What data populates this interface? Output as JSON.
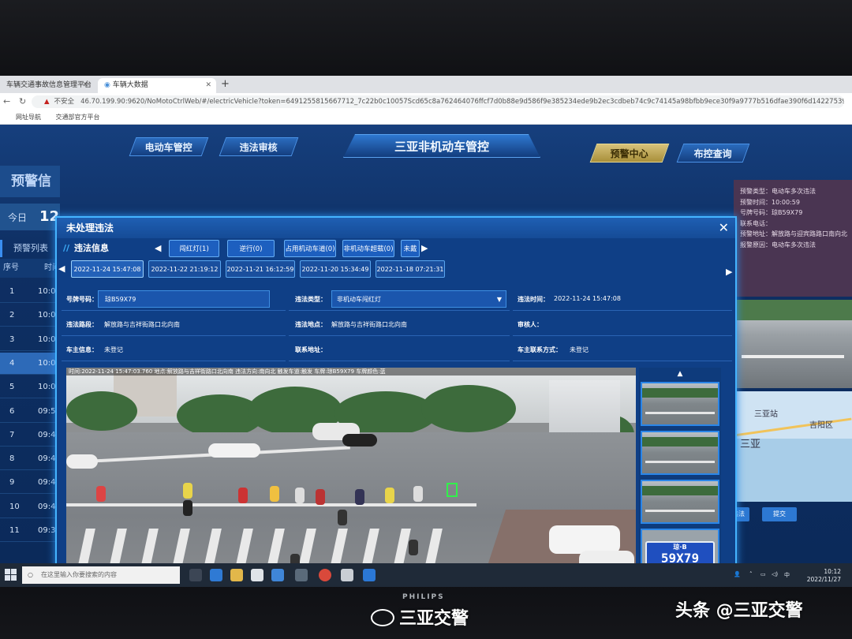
{
  "browser": {
    "tabs": [
      {
        "label": "车辆交通事故信息管理平台"
      },
      {
        "label": "车辆大数据"
      }
    ],
    "insecure_label": "不安全",
    "url": "46.70.199.90:9620/NoMotoCtrlWeb/#/electricVehicle?token=6491255815667712_7c22b0c10057Scd65c8a762464076ffcf7d0b88e9d586f9e385234ede9b2ec3cdbeb74c9c74145a98bfbb9ece30f9a9777b516dfae390f6d1422753989401272",
    "bookmarks": [
      "网址导航",
      "交通部官方平台"
    ]
  },
  "app": {
    "title": "三亚非机动车管控",
    "nav": [
      "电动车管控",
      "违法审核",
      "预警中心",
      "布控查询"
    ]
  },
  "left": {
    "heading": "预警信",
    "today_label": "今日",
    "today_count": "12",
    "list_title": "预警列表",
    "col_no": "序号",
    "col_time": "时间",
    "rows": [
      {
        "no": "1",
        "time": "10:08"
      },
      {
        "no": "2",
        "time": "10:07"
      },
      {
        "no": "3",
        "time": "10:05"
      },
      {
        "no": "4",
        "time": "10:00"
      },
      {
        "no": "5",
        "time": "10:00"
      },
      {
        "no": "6",
        "time": "09:55"
      },
      {
        "no": "7",
        "time": "09:49"
      },
      {
        "no": "8",
        "time": "09:48"
      },
      {
        "no": "9",
        "time": "09:45"
      },
      {
        "no": "10",
        "time": "09:42"
      },
      {
        "no": "11",
        "time": "09:31"
      }
    ]
  },
  "right": {
    "info_lines": [
      "预警类型：电动车多次违法",
      "预警时间：10:00:59",
      "号牌号码：琼B59X79",
      "联系电话：",
      "预警地址：解放路与迎宾路路口南向北",
      "报警原因：电动车多次违法"
    ],
    "map_labels": [
      "三亚站",
      "吉阳区",
      "三亚"
    ],
    "buttons": [
      "处理违法",
      "提交"
    ]
  },
  "dialog": {
    "title": "未处理违法",
    "section": "违法信息",
    "categories": [
      "闯红灯(1)",
      "逆行(0)",
      "占用机动车道(0)",
      "非机动车超载(0)",
      "未戴"
    ],
    "dates": [
      "2022-11-24 15:47:08",
      "2022-11-22 21:19:12",
      "2022-11-21 16:12:59",
      "2022-11-20 15:34:49",
      "2022-11-18 07:21:31"
    ],
    "fields": {
      "plate_label": "号牌号码：",
      "plate_value": "琼B59X79",
      "type_label": "违法类型：",
      "type_value": "非机动车闯红灯",
      "time_label": "违法时间：",
      "time_value": "2022-11-24 15:47:08",
      "road_label": "违法路段：",
      "road_value": "解放路与吉祥街路口北向南",
      "place_label": "违法地点：",
      "place_value": "解放路与吉祥街路口北向南",
      "reviewer_label": "审核人：",
      "reviewer_value": "",
      "owner_label": "车主信息：",
      "owner_value": "未登记",
      "address_label": "联系地址：",
      "address_value": "",
      "phone_label": "车主联系方式：",
      "phone_value": "未登记"
    },
    "video_overlay": "时间:2022-11-24 15:47:03.760 地点:解放路与吉祥街路口北向南 违法方向:南向北 触发车道:触发 车牌:琼B59X79 车牌颜色:蓝",
    "plate_top": "琼·B",
    "plate_num": "59X79"
  },
  "taskbar": {
    "search_placeholder": "在这里输入你要搜索的内容",
    "ime": "中",
    "time": "10:12",
    "date": "2022/11/27"
  },
  "monitor": {
    "brand": "PHILIPS"
  },
  "watermarks": {
    "left": "三亚交警",
    "right": "头条 @三亚交警"
  }
}
